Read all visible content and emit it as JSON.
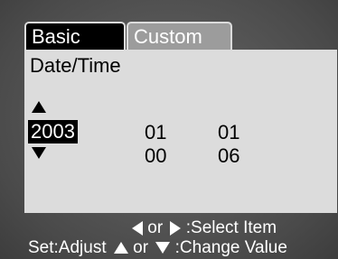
{
  "tabs": {
    "basic": "Basic",
    "custom": "Custom"
  },
  "section_title": "Date/Time",
  "date": {
    "year": "2003",
    "month": "01",
    "day": "01"
  },
  "time": {
    "hour": "00",
    "minute": "06"
  },
  "help": {
    "or_1": "or",
    "select_item": ":Select Item",
    "set_adjust": "Set:Adjust",
    "or_2": "or",
    "change_value": ":Change Value"
  },
  "icons": {
    "up": "arrow-up-icon",
    "down": "arrow-down-icon",
    "left": "arrow-left-icon",
    "right": "arrow-right-icon"
  },
  "colors": {
    "panel": "#dcdcdc",
    "background": "#5a5a5a",
    "selected": "#000000",
    "inactive_tab": "#9c9c9c"
  }
}
